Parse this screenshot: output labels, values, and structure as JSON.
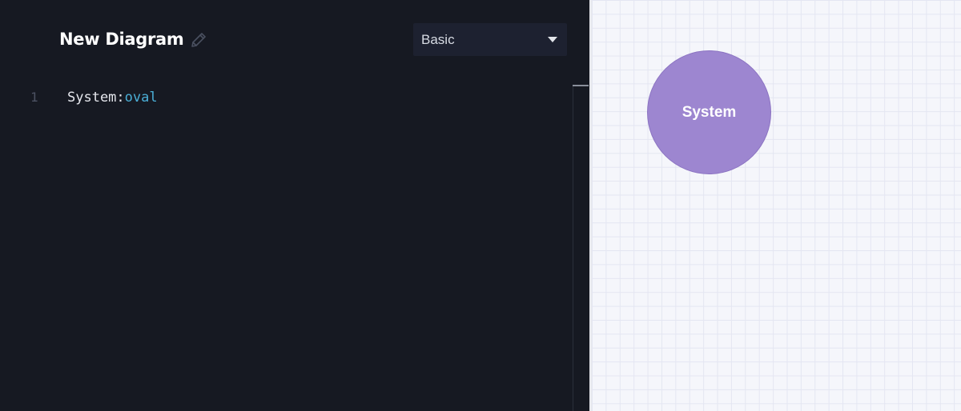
{
  "header": {
    "title": "New Diagram",
    "edit_icon": "pencil-icon"
  },
  "theme_select": {
    "value": "Basic"
  },
  "editor": {
    "lines": [
      {
        "number": "1",
        "name": "System",
        "separator": ":",
        "shape": "oval"
      }
    ]
  },
  "diagram": {
    "nodes": [
      {
        "label": "System",
        "shape": "oval",
        "fill": "#9d86d0"
      }
    ]
  },
  "colors": {
    "editor_bg": "#161922",
    "canvas_bg": "#f5f6fb",
    "keyword": "#4aaed6",
    "node_fill": "#9d86d0"
  }
}
